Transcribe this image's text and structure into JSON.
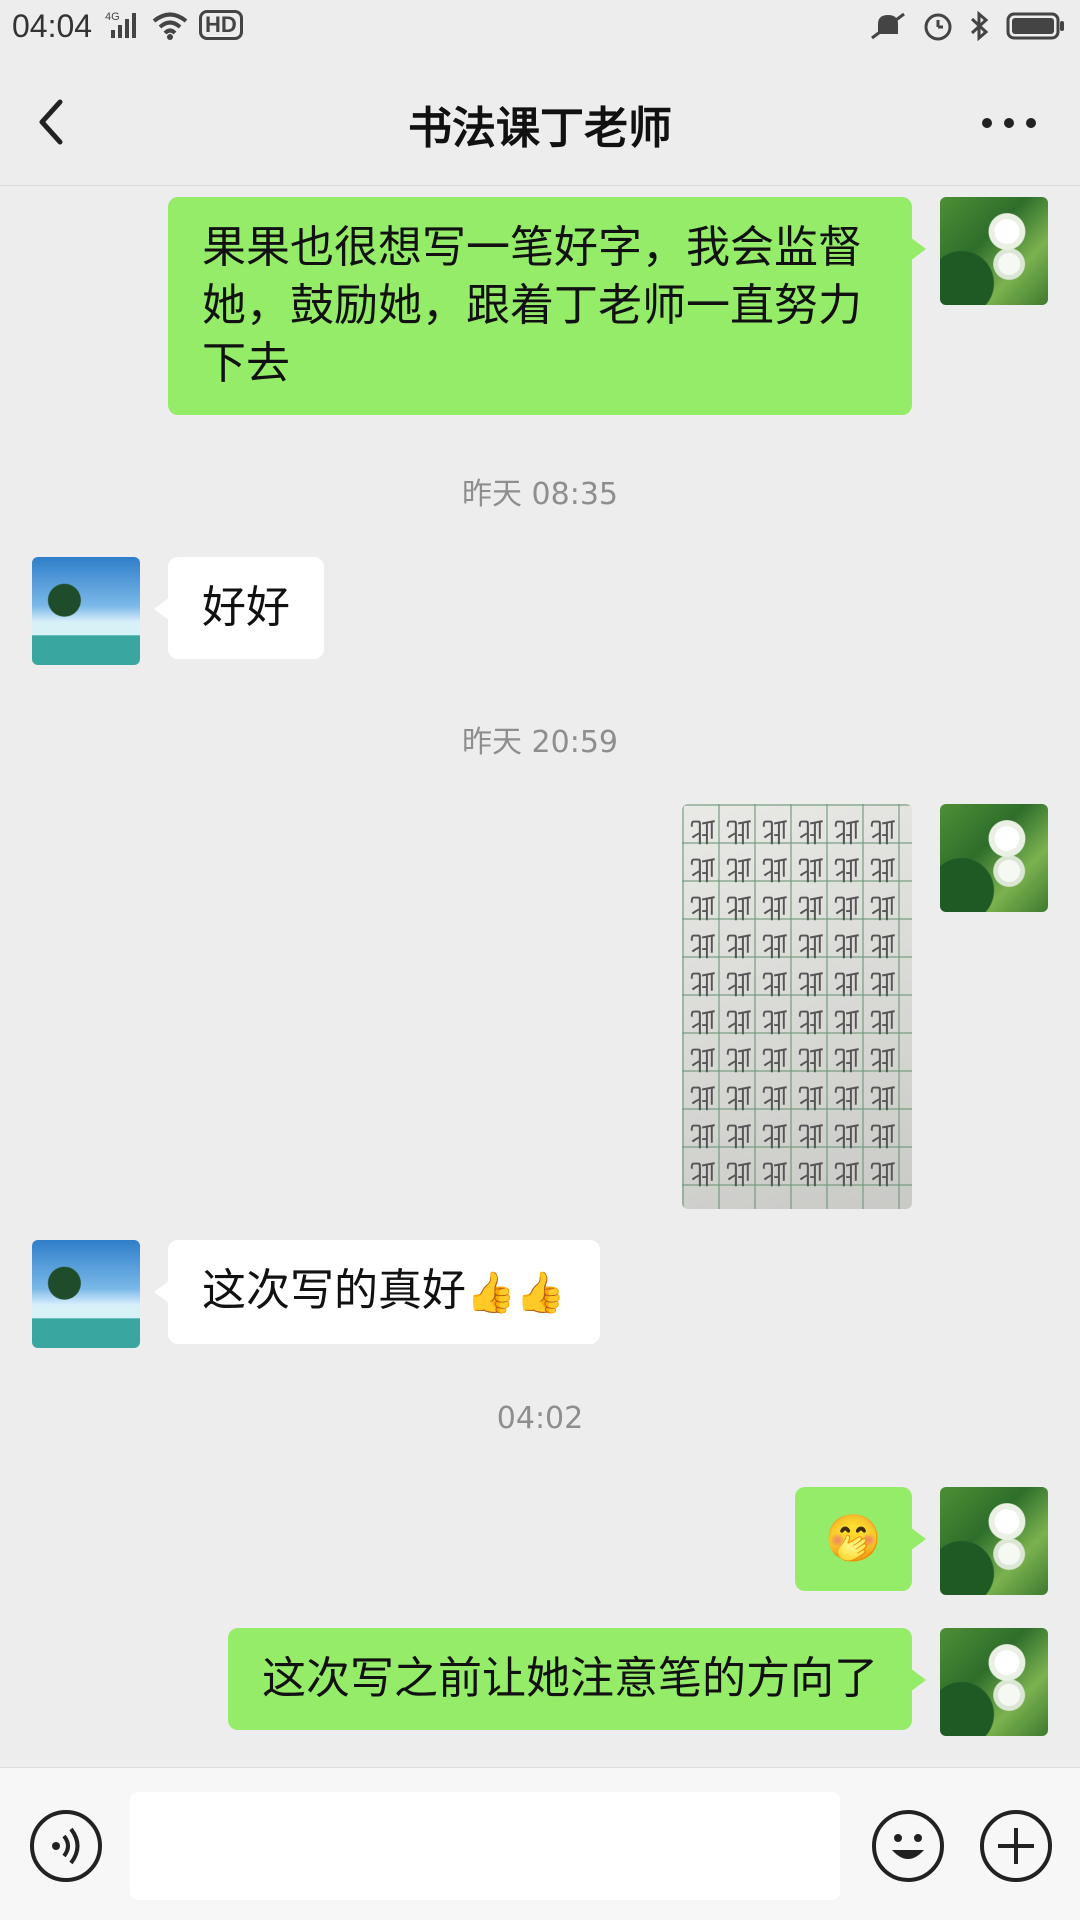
{
  "status_bar": {
    "time": "04:04",
    "network": "4G",
    "hd": "HD",
    "icons": [
      "signal-icon",
      "wifi-icon",
      "hd-icon",
      "mute-icon",
      "alarm-icon",
      "bluetooth-icon",
      "battery-icon"
    ]
  },
  "header": {
    "title": "书法课丁老师",
    "back_icon": "back-arrow-icon",
    "more_icon": "more-icon"
  },
  "messages": [
    {
      "sender": "me",
      "type": "text",
      "text": "果果也很想写一笔好字，我会监督她，鼓励她，跟着丁老师一直努力下去"
    },
    {
      "type": "timestamp",
      "text": "昨天 08:35"
    },
    {
      "sender": "them",
      "type": "text",
      "text": "好好"
    },
    {
      "type": "timestamp",
      "text": "昨天 20:59"
    },
    {
      "sender": "me",
      "type": "image",
      "content": "handwriting-practice-photo"
    },
    {
      "sender": "them",
      "type": "text",
      "text": "这次写的真好",
      "emojis": [
        "👍",
        "👍"
      ]
    },
    {
      "type": "timestamp",
      "text": "04:02"
    },
    {
      "sender": "me",
      "type": "emoji",
      "text": "🤭"
    },
    {
      "sender": "me",
      "type": "text",
      "text": "这次写之前让她注意笔的方向了"
    }
  ],
  "input_bar": {
    "placeholder": "",
    "voice_icon": "voice-icon",
    "emoji_icon": "emoji-icon",
    "plus_icon": "plus-icon"
  },
  "colors": {
    "background": "#ededed",
    "my_bubble": "#95ec69",
    "their_bubble": "#ffffff",
    "timestamp_text": "#8e8e8e"
  }
}
